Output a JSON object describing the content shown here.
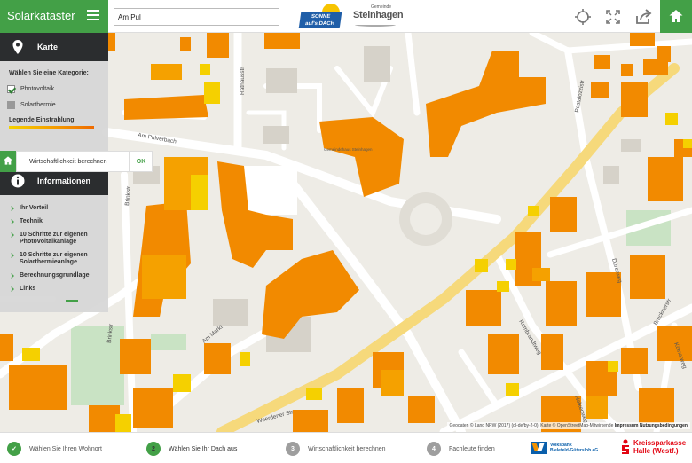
{
  "app": {
    "title": "Solarkataster",
    "search_value": "Am Pul",
    "logo_sonne_line1": "SONNE",
    "logo_sonne_line2": "auf's DACH",
    "logo_city_small": "Gemeinde",
    "logo_city": "Steinhagen"
  },
  "toolbar": {
    "icons": [
      "crosshair-icon",
      "fullscreen-icon",
      "share-icon",
      "home-icon"
    ]
  },
  "sidebar": {
    "karte_label": "Karte",
    "category_question": "Wählen Sie eine Kategorie:",
    "categories": [
      {
        "label": "Photovoltaik",
        "checked": true
      },
      {
        "label": "Solarthermie",
        "checked": false
      }
    ],
    "legend_label": "Legende Einstrahlung",
    "info_label": "Informationen",
    "info_items": [
      "Ihr Vorteil",
      "Technik",
      "10 Schritte zur eigenen Photovoltaikanlage",
      "10 Schritte zur eigenen Solarthermieanlage",
      "Berechnungsgrundlage",
      "Links"
    ]
  },
  "popup": {
    "text": "Wirtschaftlichkeit berechnen",
    "ok_label": "OK"
  },
  "map": {
    "streets": [
      "Am Pulverbach",
      "Rathausstr",
      "Brinkstr",
      "Am Markt",
      "Woerdener Str",
      "Dürerweg",
      "Rembrandtweg",
      "Brucknerstr",
      "Kölnerweg",
      "Pestalozzistr",
      "Nelkenweg",
      "Brinkstr"
    ],
    "poi_labels": [
      "Gemeindehaus Steinhagen"
    ],
    "attribution": "Geodaten © Land NRW (2017) (dl-de/by-2-0), Karte © OpenStreetMap-Mitwirkende",
    "impressum": "Impressum",
    "nutzung": "Nutzungsbedingungen"
  },
  "steps": [
    {
      "num": "✓",
      "label": "Wählen Sie Ihren Wohnort",
      "state": "done"
    },
    {
      "num": "2",
      "label": "Wählen Sie Ihr Dach aus",
      "state": "current"
    },
    {
      "num": "3",
      "label": "Wirtschaftlichkeit berechnen",
      "state": "todo"
    },
    {
      "num": "4",
      "label": "Fachleute finden",
      "state": "todo"
    }
  ],
  "sponsors": {
    "volksbank_line1": "Volksbank",
    "volksbank_line2": "Bielefeld-Gütersloh eG",
    "sparkasse_line1": "Kreissparkasse",
    "sparkasse_line2": "Halle (Westf.)"
  },
  "colors": {
    "brand_green": "#43a047",
    "roof_orange": "#f28a00",
    "roof_yellow": "#f5d000",
    "panel_dark": "#2b2d2f"
  }
}
